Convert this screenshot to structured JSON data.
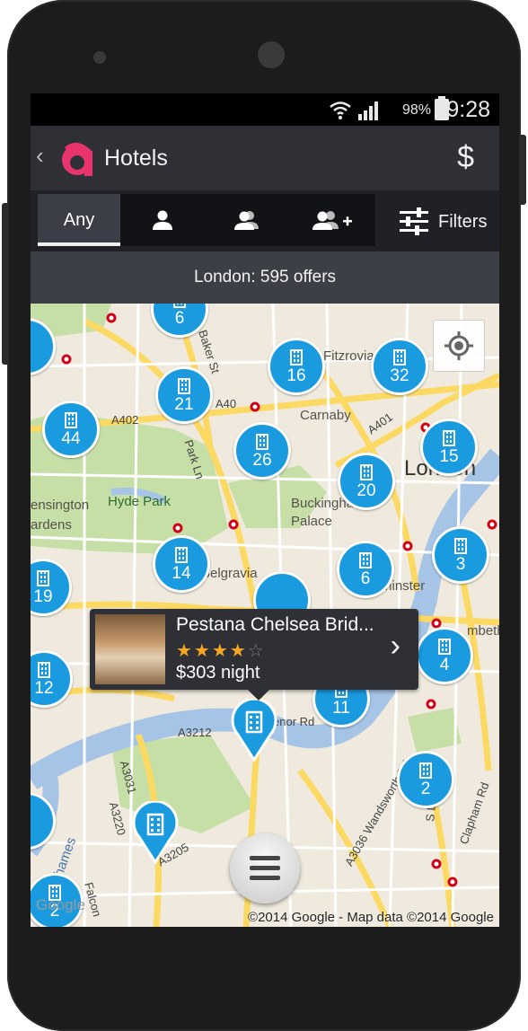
{
  "status_bar": {
    "battery_percent": "98%",
    "time": "19:28"
  },
  "action_bar": {
    "back_icon": "chevron-left-icon",
    "logo_letter": "a",
    "title": "Hotels",
    "currency_symbol": "$"
  },
  "guest_tabs": {
    "any_label": "Any",
    "tabs": [
      "one-person-icon",
      "two-people-icon",
      "group-plus-icon"
    ],
    "filters_label": "Filters"
  },
  "offers_text": "London: 595 offers",
  "map": {
    "clusters": [
      "6",
      "16",
      "32",
      "21",
      "44",
      "26",
      "20",
      "15",
      "14",
      "6",
      "3",
      "19",
      "4",
      "12",
      "11",
      "2",
      "2"
    ],
    "labels": {
      "fitzrovia": "Fitzrovia",
      "carnaby": "Carnaby",
      "london": "London",
      "hyde_park": "Hyde Park",
      "kensington": "ensington",
      "gardens": "ardens",
      "buckingham": "Buckingham",
      "palace": "Palace",
      "belgravia": "Belgravia",
      "westminster": "estminster",
      "lambeth": "mbeth",
      "thames": "Thames"
    },
    "roads": {
      "a40": "A40",
      "a402": "A402",
      "a401": "A401",
      "baker_st": "Baker St",
      "park_ln": "Park Ln",
      "a3212": "A3212",
      "grosvenor_rd": "enor Rd",
      "a3031": "A3031",
      "a3220": "A3220",
      "a3205": "A3205",
      "a3036": "A3036 Wandsworth Rd",
      "clapham_rd": "Clapham Rd",
      "s_lambeth": "S Lambeth",
      "falcon": "Falcon"
    },
    "attribution": "©2014 Google - Map data ©2014 Google",
    "google_watermark": "Google"
  },
  "popup": {
    "hotel_name": "Pestana Chelsea Brid...",
    "stars_filled": 4,
    "stars_total": 5,
    "price": "$303 night"
  },
  "colors": {
    "accent": "#e8336d",
    "cluster": "#1a9be0",
    "bar": "#2e3036",
    "water": "#a5c4e6",
    "park": "#c6dfa6",
    "road_major": "#fcd963"
  }
}
